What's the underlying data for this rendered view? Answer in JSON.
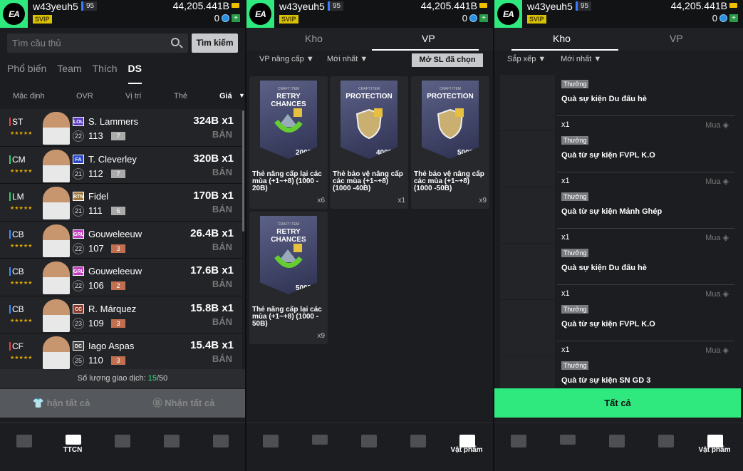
{
  "header": {
    "logo": "EA",
    "username": "w43yeuh5",
    "level": "95",
    "vip": "SVIP",
    "coins": "44,205.441B",
    "points": "0"
  },
  "market": {
    "search": {
      "placeholder": "Tìm cầu thủ",
      "button": "Tìm kiếm"
    },
    "tabs": [
      "Phổ biến",
      "Team",
      "Thích",
      "DS"
    ],
    "active_tab": "DS",
    "sort": {
      "default": "Mặc định",
      "ovr": "OVR",
      "position": "Vị trí",
      "card": "Thẻ",
      "price": "Giá"
    },
    "players": [
      {
        "pos": "ST",
        "season": "LOL",
        "name": "S. Lammers",
        "ovr_level": "22",
        "ovr": "113",
        "upgrade": "7",
        "price": "324B",
        "qty": "x1",
        "sell": "BÁN",
        "pos_color": "#e84040",
        "season_color": "#5b3cbf",
        "upg_color": "#aaaaaa",
        "stars": "★★★★★"
      },
      {
        "pos": "CM",
        "season": "FA",
        "name": "T. Cleverley",
        "ovr_level": "21",
        "ovr": "112",
        "upgrade": "7",
        "price": "320B",
        "qty": "x1",
        "sell": "BÁN",
        "pos_color": "#2fcf6a",
        "season_color": "#2a47c8",
        "upg_color": "#aaaaaa",
        "stars": "★★★★★"
      },
      {
        "pos": "LM",
        "season": "RTN",
        "name": "Fidel",
        "ovr_level": "21",
        "ovr": "111",
        "upgrade": "6",
        "price": "170B",
        "qty": "x1",
        "sell": "BÁN",
        "pos_color": "#2fcf6a",
        "season_color": "#a07a3a",
        "upg_color": "#aaaaaa",
        "stars": "★★★★★"
      },
      {
        "pos": "CB",
        "season": "GRU",
        "name": "Gouweleeuw",
        "ovr_level": "22",
        "ovr": "107",
        "upgrade": "3",
        "price": "26.4B",
        "qty": "x1",
        "sell": "BÁN",
        "pos_color": "#3a8cff",
        "season_color": "#c23cc2",
        "upg_color": "#c07050",
        "stars": "★★★★★"
      },
      {
        "pos": "CB",
        "season": "GRU",
        "name": "Gouweleeuw",
        "ovr_level": "22",
        "ovr": "106",
        "upgrade": "2",
        "price": "17.6B",
        "qty": "x1",
        "sell": "BÁN",
        "pos_color": "#3a8cff",
        "season_color": "#c23cc2",
        "upg_color": "#c07050",
        "stars": "★★★★★"
      },
      {
        "pos": "CB",
        "season": "CC",
        "name": "R. Márquez",
        "ovr_level": "23",
        "ovr": "109",
        "upgrade": "3",
        "price": "15.8B",
        "qty": "x1",
        "sell": "BÁN",
        "pos_color": "#3a8cff",
        "season_color": "#8a3a2a",
        "upg_color": "#c07050",
        "stars": "★★★★★"
      },
      {
        "pos": "CF",
        "season": "DC",
        "name": "Iago Aspas",
        "ovr_level": "25",
        "ovr": "110",
        "upgrade": "3",
        "price": "15.4B",
        "qty": "x1",
        "sell": "BÁN",
        "pos_color": "#e84040",
        "season_color": "#444444",
        "upg_color": "#c07050",
        "stars": "★★★★★"
      }
    ],
    "trade_label": "Số lượng giao dịch: ",
    "trade_used": "15",
    "trade_total": "/50",
    "receive_players": "hận tất cả",
    "receive_coins": "Nhận tất cả"
  },
  "nav": {
    "market": "TTCN",
    "items": "Vật phẩm"
  },
  "items": {
    "tabs": [
      "Kho",
      "VP"
    ],
    "active_tab": "VP",
    "filter1": "VP nâng cấp",
    "filter2": "Mới nhất",
    "open_button": "Mở SL đã chọn",
    "cards": [
      {
        "type": "RETRY CHANCES",
        "craft": "CRAFT ITEM",
        "value": "200B",
        "desc": "Thẻ nâng cấp lại các mùa (+1~+8) (1000 - 20B)",
        "qty": "x6"
      },
      {
        "type": "PROTECTION",
        "craft": "CRAFT ITEM",
        "value": "400B",
        "desc": "Thẻ bảo vệ nâng cấp các mùa (+1~+8) (1000 -40B)",
        "qty": "x1"
      },
      {
        "type": "PROTECTION",
        "craft": "CRAFT ITEM",
        "value": "500B",
        "desc": "Thẻ bảo vệ nâng cấp các mùa (+1~+8) (1000 -50B)",
        "qty": "x9"
      },
      {
        "type": "RETRY CHANCES",
        "craft": "CRAFT ITEM",
        "value": "500B",
        "desc": "Thẻ nâng cấp lại các mùa (+1~+8) (1000 - 50B)",
        "qty": "x9"
      }
    ]
  },
  "storage": {
    "tabs": [
      "Kho",
      "VP"
    ],
    "active_tab": "Kho",
    "filter1": "Sắp xếp",
    "filter2": "Mới nhất",
    "list": [
      {
        "tag": "Thưởng",
        "name": "Quà sự kiện Du đấu hè",
        "qty": "x1",
        "buy": "Mua"
      },
      {
        "tag": "Thưởng",
        "name": "Quà từ sự kiện FVPL K.O",
        "qty": "x1",
        "buy": "Mua"
      },
      {
        "tag": "Thưởng",
        "name": "Quà từ sự kiện Mảnh Ghép",
        "qty": "x1",
        "buy": "Mua"
      },
      {
        "tag": "Thưởng",
        "name": "Quà sự kiện Du đấu hè",
        "qty": "x1",
        "buy": "Mua"
      },
      {
        "tag": "Thưởng",
        "name": "Quà từ sự kiện FVPL K.O",
        "qty": "x1",
        "buy": "Mua"
      },
      {
        "tag": "Thưởng",
        "name": "Quà từ sự kiện SN GD 3",
        "qty": "",
        "buy": ""
      }
    ],
    "all_button": "Tất cả"
  }
}
